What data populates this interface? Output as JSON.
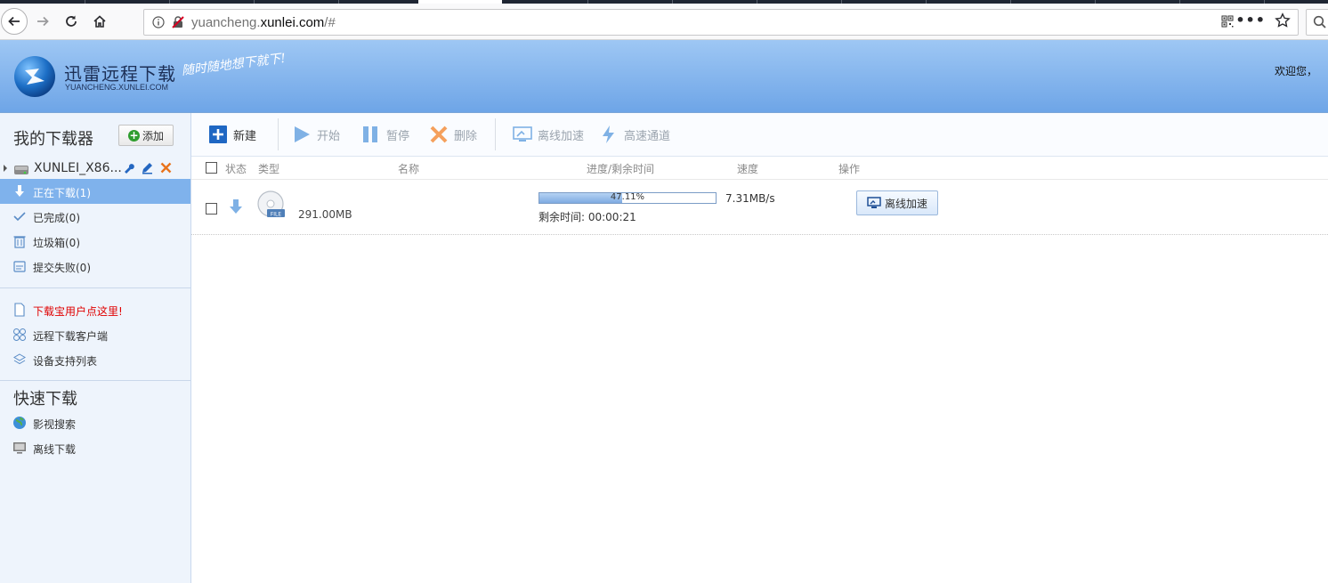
{
  "browser": {
    "url_prefix": "yuancheng.",
    "url_domain": "xunlei.com",
    "url_suffix": "/#"
  },
  "header": {
    "brand_title": "迅雷远程下载",
    "brand_sub": "YUANCHENG.XUNLEI.COM",
    "slogan": "随时随地想下就下!",
    "welcome": "欢迎您，",
    "welcome_extra": "",
    "colors": {
      "header_top": "#9ec7f4",
      "header_bottom": "#6ea5e7"
    }
  },
  "sidebar": {
    "title": "我的下载器",
    "add_label": "添加",
    "device_name": "XUNLEI_X86...",
    "items": [
      {
        "label": "正在下载(1)",
        "icon": "download-arrow-icon"
      },
      {
        "label": "已完成(0)",
        "icon": "checkmark-icon"
      },
      {
        "label": "垃圾箱(0)",
        "icon": "trash-icon"
      },
      {
        "label": "提交失败(0)",
        "icon": "failed-doc-icon"
      }
    ],
    "links": [
      {
        "label": "下载宝用户点这里!",
        "icon": "document-icon"
      },
      {
        "label": "远程下载客户端",
        "icon": "client-grid-icon"
      },
      {
        "label": "设备支持列表",
        "icon": "layers-icon"
      }
    ],
    "quick_title": "快速下载",
    "quick": [
      {
        "label": "影视搜索",
        "icon": "globe-icon"
      },
      {
        "label": "离线下载",
        "icon": "offline-monitor-icon"
      }
    ]
  },
  "toolbar": {
    "new": "新建",
    "start": "开始",
    "pause": "暂停",
    "delete": "删除",
    "offline": "离线加速",
    "highspeed": "高速通道"
  },
  "table": {
    "headers": {
      "status": "状态",
      "type": "类型",
      "name": "名称",
      "progress": "进度/剩余时间",
      "speed": "速度",
      "action": "操作"
    },
    "rows": [
      {
        "size": "291.00MB",
        "progress": 0.4711,
        "progress_text": "47.11%",
        "remaining": "剩余时间: 00:00:21",
        "speed": "7.31MB/s",
        "action": "离线加速",
        "file_badge": "FILE"
      }
    ]
  }
}
